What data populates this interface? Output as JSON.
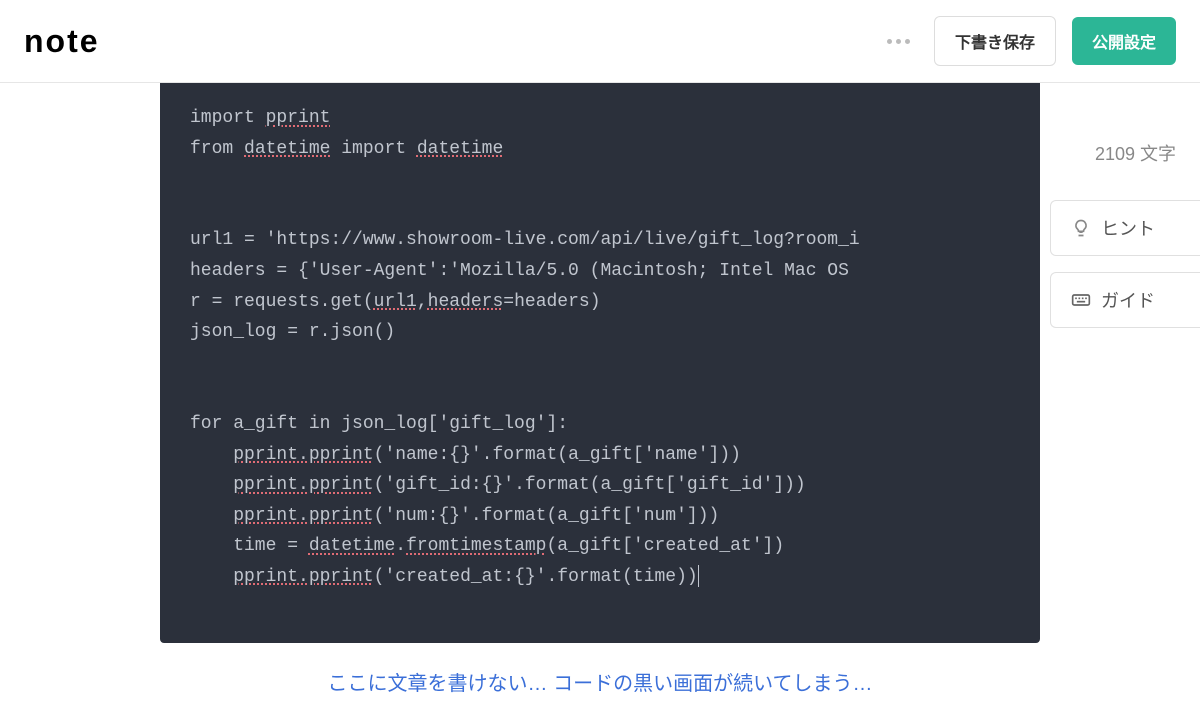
{
  "header": {
    "logo": "note",
    "draft_button": "下書き保存",
    "publish_button": "公開設定"
  },
  "editor": {
    "char_count": "2109",
    "char_suffix": "文字",
    "code_lines": [
      "import pprint",
      "from datetime import datetime",
      "",
      "",
      "url1 = 'https://www.showroom-live.com/api/live/gift_log?room_i",
      "headers = {'User-Agent':'Mozilla/5.0 (Macintosh; Intel Mac OS ",
      "r = requests.get(url1,headers=headers)",
      "json_log = r.json()",
      "",
      "",
      "for a_gift in json_log['gift_log']:",
      "    pprint.pprint('name:{}'.format(a_gift['name']))",
      "    pprint.pprint('gift_id:{}'.format(a_gift['gift_id']))",
      "    pprint.pprint('num:{}'.format(a_gift['num']))",
      "    time = datetime.fromtimestamp(a_gift['created_at'])",
      "    pprint.pprint('created_at:{}'.format(time))"
    ],
    "caption": "ここに文章を書けない… コードの黒い画面が続いてしまう…"
  },
  "sidebar": {
    "hint_label": "ヒント",
    "guide_label": "ガイド"
  }
}
